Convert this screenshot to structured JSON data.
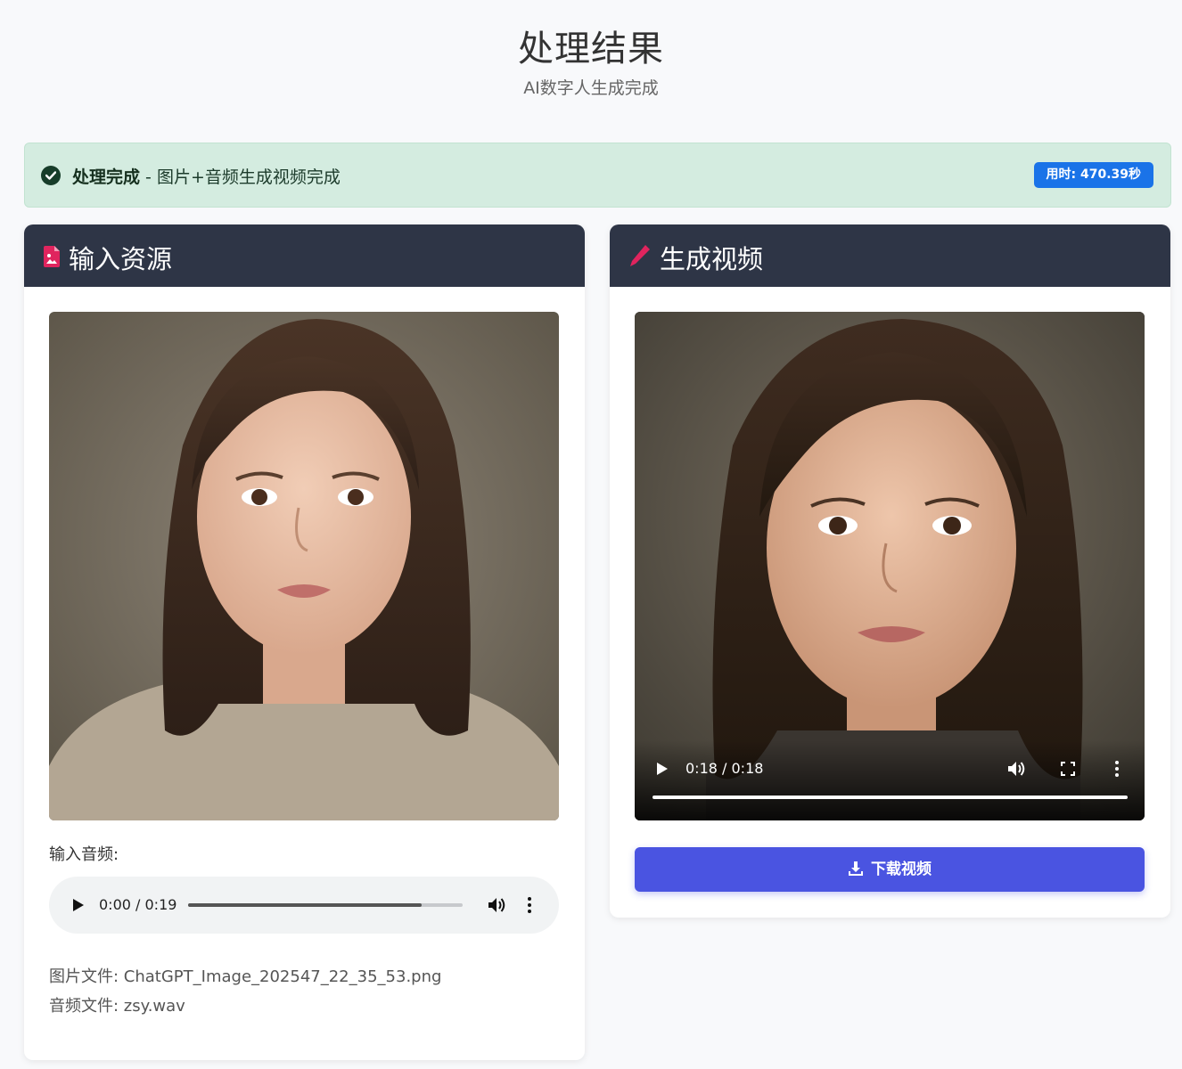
{
  "header": {
    "title": "处理结果",
    "subtitle": "AI数字人生成完成"
  },
  "alert": {
    "status": "处理完成",
    "message": " - 图片+音频生成视频完成",
    "time_badge": "用时: 470.39秒"
  },
  "input_card": {
    "title": "输入资源",
    "audio_label": "输入音频:",
    "audio_player": {
      "time": "0:00 / 0:19",
      "buffered_fraction": 0.85
    },
    "image_file": "图片文件: ChatGPT_Image_202547_22_35_53.png",
    "audio_file": "音频文件: zsy.wav"
  },
  "output_card": {
    "title": "生成视频",
    "video_player": {
      "time": "0:18 / 0:18",
      "progress_fraction": 1.0
    },
    "download_label": "下载视频"
  },
  "colors": {
    "header_bg": "#2e3546",
    "alert_bg": "#d4ece0",
    "badge_bg": "#1a73e8",
    "accent_pink": "#e0245e",
    "download_bg": "#4a54e1"
  }
}
